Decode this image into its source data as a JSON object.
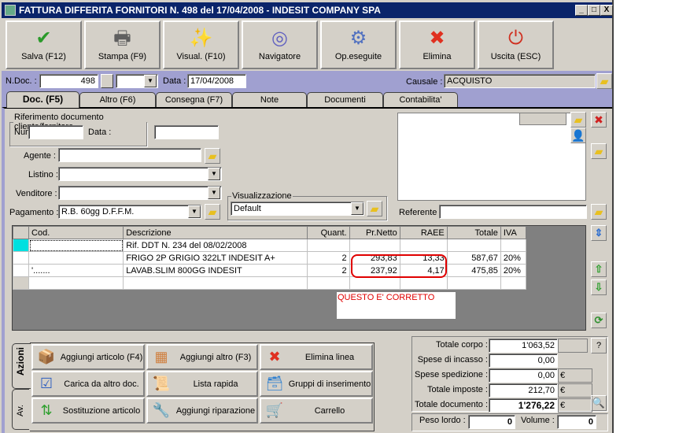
{
  "window": {
    "title": "FATTURA DIFFERITA FORNITORI N. 498  del 17/04/2008 - INDESIT COMPANY SPA",
    "minimize": "_",
    "maximize": "□",
    "close": "X"
  },
  "toolbar": [
    {
      "label": "Salva (F12)",
      "icon": "check-icon",
      "glyph": "✔",
      "color": "#2a9a2a"
    },
    {
      "label": "Stampa (F9)",
      "icon": "printer-icon",
      "glyph": "🖶",
      "color": "#606060"
    },
    {
      "label": "Visual. (F10)",
      "icon": "magic-wand-icon",
      "glyph": "✨",
      "color": "#d0a000"
    },
    {
      "label": "Navigatore",
      "icon": "compass-icon",
      "glyph": "◎",
      "color": "#6060c0"
    },
    {
      "label": "Op.eseguite",
      "icon": "gears-search-icon",
      "glyph": "⚙",
      "color": "#5070c0"
    },
    {
      "label": "Elimina",
      "icon": "delete-x-icon",
      "glyph": "✖",
      "color": "#e03020"
    },
    {
      "label": "Uscita (ESC)",
      "icon": "power-icon",
      "glyph": "⏻",
      "color": "#d03020"
    }
  ],
  "header": {
    "ndoc_label": "N.Doc. :",
    "ndoc_value": "498",
    "data_label": "Data :",
    "data_value": "17/04/2008",
    "causale_label": "Causale :",
    "causale_value": "ACQUISTO"
  },
  "tabs": [
    "Doc. (F5)",
    "Altro (F6)",
    "Consegna (F7)",
    "Note",
    "Documenti",
    "Contabilita'"
  ],
  "doc": {
    "rif_legend": "Riferimento documento cliente/fornitore",
    "num_label": "Num.:",
    "num_value": "",
    "data_label": "Data :",
    "data_value": "",
    "agente_label": "Agente :",
    "listino_label": "Listino :",
    "venditore_label": "Venditore :",
    "pagamento_label": "Pagamento :",
    "pagamento_value": "R.B. 60gg D.F.F.M.",
    "vis_legend": "Visualizzazione",
    "vis_value": "Default",
    "referente_label": "Referente",
    "referente_value": ""
  },
  "grid": {
    "columns": [
      "Cod.",
      "Descrizione",
      "Quant.",
      "Pr.Netto",
      "RAEE",
      "Totale",
      "IVA"
    ],
    "rows": [
      {
        "cod": "",
        "desc": "Rif. DDT N. 234 del 08/02/2008",
        "qty": "",
        "price": "",
        "raee": "",
        "total": "",
        "iva": ""
      },
      {
        "cod": "",
        "desc": "FRIGO 2P GRIGIO 322LT INDESIT A+",
        "qty": "2",
        "price": "293,83",
        "raee": "13,33",
        "total": "587,67",
        "iva": "20%"
      },
      {
        "cod": "'.......",
        "desc": "LAVAB.SLIM 800GG INDESIT",
        "qty": "2",
        "price": "237,92",
        "raee": "4,17",
        "total": "475,85",
        "iva": "20%"
      },
      {
        "cod": "",
        "desc": "",
        "qty": "",
        "price": "",
        "raee": "",
        "total": "",
        "iva": ""
      }
    ],
    "annotation": "QUESTO E' CORRETTO",
    "highlight_color": "#e00000"
  },
  "actions": {
    "tab_azioni": "Azioni",
    "tab_av": "Av.",
    "buttons": [
      {
        "label": "Aggiungi articolo (F4)",
        "icon": "add-article-icon",
        "glyph": "📦"
      },
      {
        "label": "Aggiungi altro (F3)",
        "icon": "add-other-icon",
        "glyph": "▦"
      },
      {
        "label": "Elimina linea",
        "icon": "delete-line-icon",
        "glyph": "✖"
      },
      {
        "label": "Carica da altro doc.",
        "icon": "load-doc-icon",
        "glyph": "☑"
      },
      {
        "label": "Lista rapida",
        "icon": "quick-list-icon",
        "glyph": "📜"
      },
      {
        "label": "Gruppi di inserimento",
        "icon": "insert-groups-icon",
        "glyph": "🗃"
      },
      {
        "label": "Sostituzione articolo",
        "icon": "replace-article-icon",
        "glyph": "⇅"
      },
      {
        "label": "Aggiungi riparazione",
        "icon": "wrench-icon",
        "glyph": "🔧"
      },
      {
        "label": "Carrello",
        "icon": "cart-icon",
        "glyph": "🛒"
      }
    ]
  },
  "totals": {
    "corpo_label": "Totale corpo :",
    "corpo_value": "1'063,52",
    "help": "?",
    "incasso_label": "Spese di incasso :",
    "incasso_value": "0,00",
    "spedizione_label": "Spese spedizione :",
    "spedizione_value": "0,00",
    "imposte_label": "Totale imposte :",
    "imposte_value": "212,70",
    "documento_label": "Totale documento :",
    "documento_value": "1'276,22",
    "currency": "€",
    "peso_label": "Peso lordo :",
    "peso_value": "0",
    "volume_label": "Volume :",
    "volume_value": "0"
  }
}
